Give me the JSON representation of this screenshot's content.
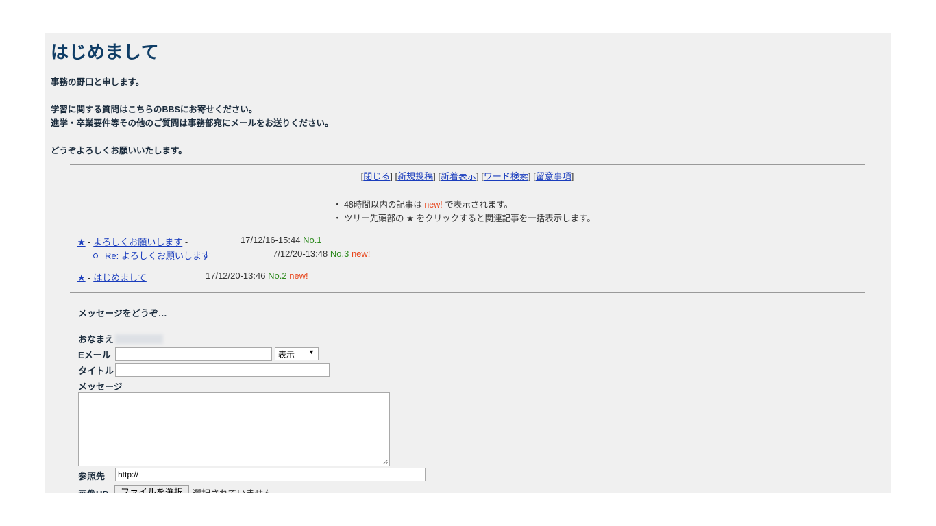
{
  "page": {
    "title": "はじめまして",
    "intro_lines": [
      "事務の野口と申します。",
      "学習に関する質問はこちらのBBSにお寄せください。",
      "進学・卒業要件等その他のご質問は事務部宛にメールをお送りください。",
      "どうぞよろしくお願いいたします。"
    ]
  },
  "nav": {
    "items": [
      "閉じる",
      "新規投稿",
      "新着表示",
      "ワード検索",
      "留意事項"
    ]
  },
  "notes": {
    "line1_prefix": "・ 48時間以内の記事は ",
    "line1_new": "new!",
    "line1_suffix": " で表示されます。",
    "line2": "・ ツリー先頭部の ★ をクリックすると関連記事を一括表示します。"
  },
  "threads": [
    {
      "star": "★",
      "sep": " - ",
      "title": "よろしくお願いします",
      "trail": " -",
      "date": "17/12/16-15:44",
      "no": "No.1",
      "new": ""
    },
    {
      "title": "Re: よろしくお願いします",
      "date": "7/12/20-13:48",
      "no": "No.3",
      "new": "new!"
    },
    {
      "star": "★",
      "sep": " - ",
      "title": "はじめまして",
      "date": "17/12/20-13:46",
      "no": "No.2",
      "new": "new!"
    }
  ],
  "form": {
    "heading": "メッセージをどうぞ…",
    "name_label": "おなまえ",
    "email_label": "Eメール",
    "email_value": "",
    "email_display_option": "表示",
    "subject_label": "タイトル",
    "subject_value": "",
    "message_label": "メッセージ",
    "message_value": "",
    "url_label": "参照先",
    "url_value": "http://",
    "image_label": "画像UP",
    "file_button": "ファイルを選択",
    "file_status": "選択されていません"
  },
  "colors": {
    "panel_bg": "#f0f0f0",
    "title": "#0f3d66",
    "link": "#1a3dbd",
    "new": "#e8461c",
    "no": "#2d8a1e"
  }
}
